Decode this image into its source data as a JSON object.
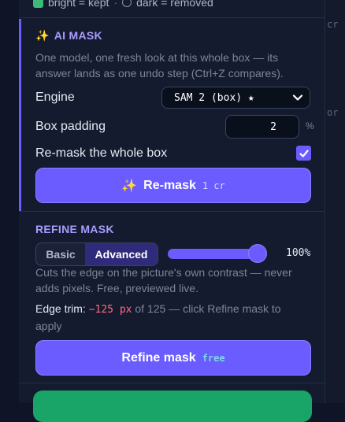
{
  "legend": {
    "bright": "bright = kept",
    "separator": "·",
    "dark": "dark = removed"
  },
  "right_peek": {
    "top_text": "cr",
    "mid_text": "or"
  },
  "ai_mask": {
    "title": "AI MASK",
    "description": "One model, one fresh look at this whole box — its answer lands as one undo step (Ctrl+Z compares).",
    "engine_label": "Engine",
    "engine_value": "SAM 2 (box) ★",
    "padding_label": "Box padding",
    "padding_value": "2",
    "padding_unit": "%",
    "remask_label": "Re-mask the whole box",
    "remask_checked": true,
    "button_label": "Re-mask",
    "button_cost": "1 cr"
  },
  "refine_mask": {
    "title": "REFINE MASK",
    "mode_options": [
      "Basic",
      "Advanced"
    ],
    "mode_selected": "Advanced",
    "slider_value": 100,
    "slider_text": "100%",
    "description": "Cuts the edge on the picture's own contrast — never adds pixels. Free, previewed live.",
    "edge_trim_label": "Edge trim:",
    "edge_trim_value": "−125 px",
    "edge_trim_suffix": "of 125 — click Refine mask to apply",
    "button_label": "Refine mask",
    "button_cost": "free"
  },
  "colors": {
    "accent": "#6a5cff",
    "panel": "#141b2e",
    "green": "#19a567",
    "trim": "#ff6b81"
  }
}
